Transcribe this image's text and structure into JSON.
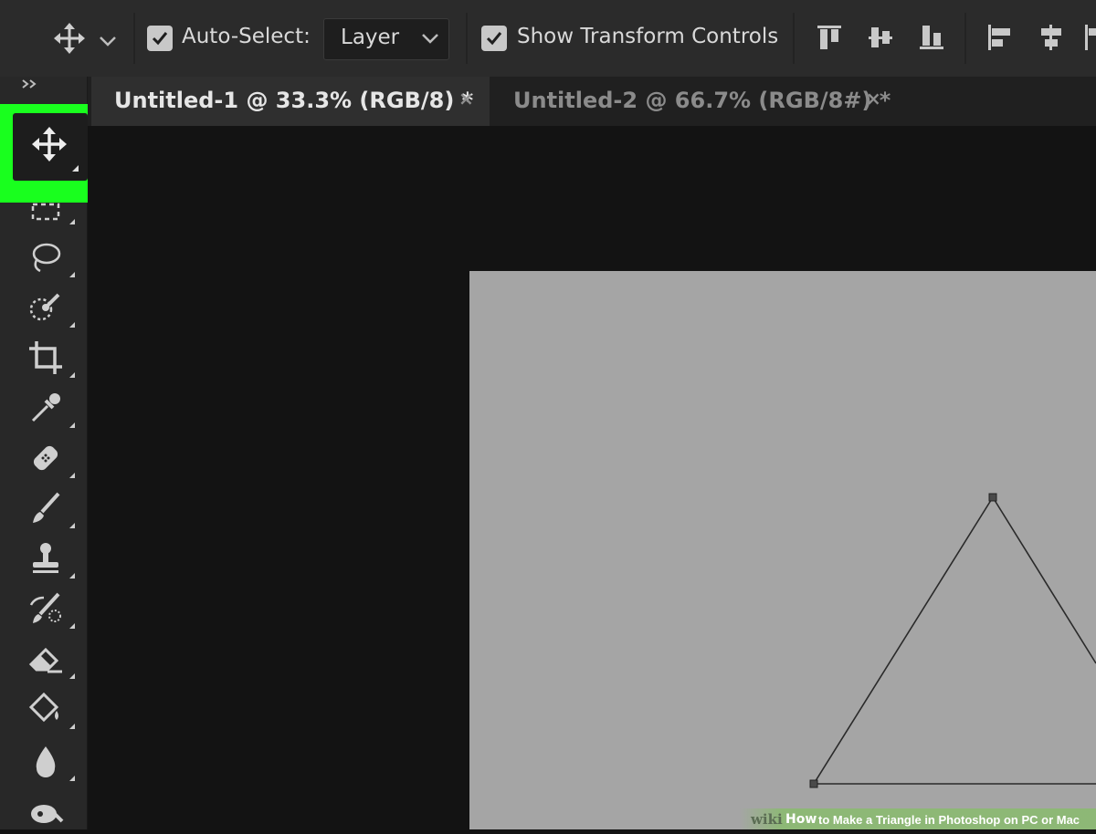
{
  "options_bar": {
    "auto_select_label": "Auto-Select:",
    "auto_select_checked": true,
    "layer_dropdown_value": "Layer",
    "show_transform_label": "Show Transform Controls",
    "show_transform_checked": true
  },
  "tabs": [
    {
      "label": "Untitled-1 @ 33.3% (RGB/8) *",
      "active": true,
      "close": "×"
    },
    {
      "label": "Untitled-2 @ 66.7% (RGB/8#) *",
      "active": false,
      "close": "×"
    }
  ],
  "toolbar": {
    "tools": [
      "move-tool",
      "rectangular-marquee-tool",
      "lasso-tool",
      "quick-selection-tool",
      "crop-tool",
      "eyedropper-tool",
      "spot-healing-tool",
      "brush-tool",
      "clone-stamp-tool",
      "history-brush-tool",
      "eraser-tool",
      "paint-bucket-tool",
      "blur-tool",
      "dodge-tool"
    ],
    "selected_tool": "move-tool"
  },
  "colors": {
    "highlight": "#19ff1e",
    "canvas": "#a5a5a5",
    "workspace": "#131313",
    "panel": "#2b2b2b"
  },
  "watermark": {
    "wiki": "wiki",
    "how": "How",
    "rest": "to Make a Triangle in Photoshop on PC or Mac"
  }
}
